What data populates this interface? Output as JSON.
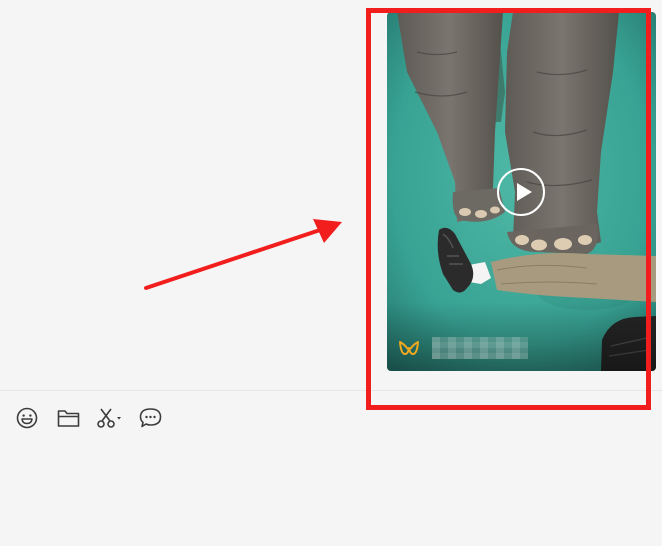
{
  "chat": {
    "video_message": {
      "source_name": "",
      "play_label": "Play video"
    }
  },
  "composer": {
    "tools": [
      {
        "name": "emoji",
        "icon": "smiley-face-icon"
      },
      {
        "name": "file",
        "icon": "folder-icon"
      },
      {
        "name": "screenshot",
        "icon": "scissors-icon"
      },
      {
        "name": "chat-history",
        "icon": "speech-bubble-icon"
      }
    ]
  },
  "annotation": {
    "highlight_color": "#f21d1d",
    "arrow_color": "#f21d1d"
  }
}
